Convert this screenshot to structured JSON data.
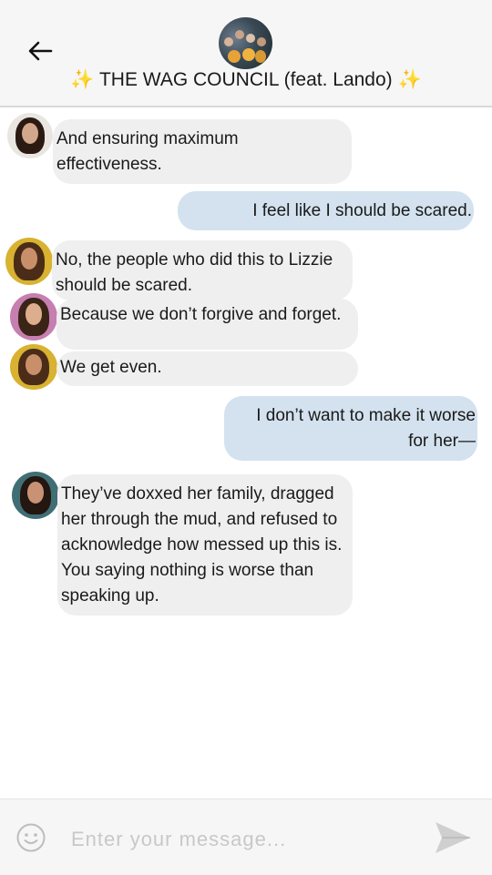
{
  "header": {
    "sparkle_left": "✨",
    "title": "THE WAG COUNCIL (feat. Lando)",
    "sparkle_right": "✨"
  },
  "messages": [
    {
      "side": "in",
      "text": "And ensuring maximum effectiveness."
    },
    {
      "side": "out",
      "text": "I feel like I should be scared."
    },
    {
      "side": "in",
      "text": "No, the people who did this to Lizzie should be scared."
    },
    {
      "side": "in",
      "text": "Because we don’t forgive and forget."
    },
    {
      "side": "in",
      "text": "We get even."
    },
    {
      "side": "out",
      "text": "I don’t want to make it worse for her—"
    },
    {
      "side": "in",
      "text": "They’ve doxxed her family, dragged her through the mud, and refused to acknowledge how messed up this is. You saying nothing is worse than speaking up."
    }
  ],
  "composer": {
    "placeholder": "Enter your message..."
  },
  "icons": {
    "back": "arrow-left-icon",
    "emoji": "smiley-icon",
    "send": "send-icon"
  },
  "colors": {
    "incoming_bubble": "#efefef",
    "outgoing_bubble": "#d3e2ee",
    "sparkle": "#f2b822"
  }
}
